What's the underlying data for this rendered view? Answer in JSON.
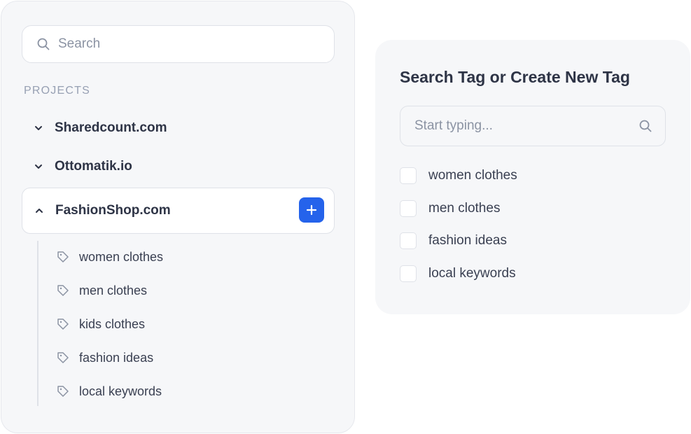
{
  "sidebar": {
    "search": {
      "placeholder": "Search",
      "icon": "search-icon"
    },
    "section_label": "PROJECTS",
    "projects": [
      {
        "name": "Sharedcount.com",
        "expanded": false,
        "icon": "chevron-down-icon"
      },
      {
        "name": "Ottomatik.io",
        "expanded": false,
        "icon": "chevron-down-icon"
      },
      {
        "name": "FashionShop.com",
        "expanded": true,
        "icon": "chevron-up-icon"
      }
    ],
    "add_button_icon": "plus-icon",
    "tags": [
      {
        "label": "women clothes",
        "icon": "tag-icon"
      },
      {
        "label": "men clothes",
        "icon": "tag-icon"
      },
      {
        "label": "kids clothes",
        "icon": "tag-icon"
      },
      {
        "label": "fashion ideas",
        "icon": "tag-icon"
      },
      {
        "label": "local keywords",
        "icon": "tag-icon"
      }
    ]
  },
  "tag_picker": {
    "title": "Search Tag or Create New Tag",
    "search_placeholder": "Start typing...",
    "options": [
      {
        "label": "women clothes",
        "checked": false
      },
      {
        "label": "men clothes",
        "checked": false
      },
      {
        "label": "fashion ideas",
        "checked": false
      },
      {
        "label": "local keywords",
        "checked": false
      }
    ]
  },
  "colors": {
    "accent": "#2563eb",
    "panel_bg": "#f6f7f9",
    "text_primary": "#2e3446",
    "text_muted": "#97a0b3"
  }
}
